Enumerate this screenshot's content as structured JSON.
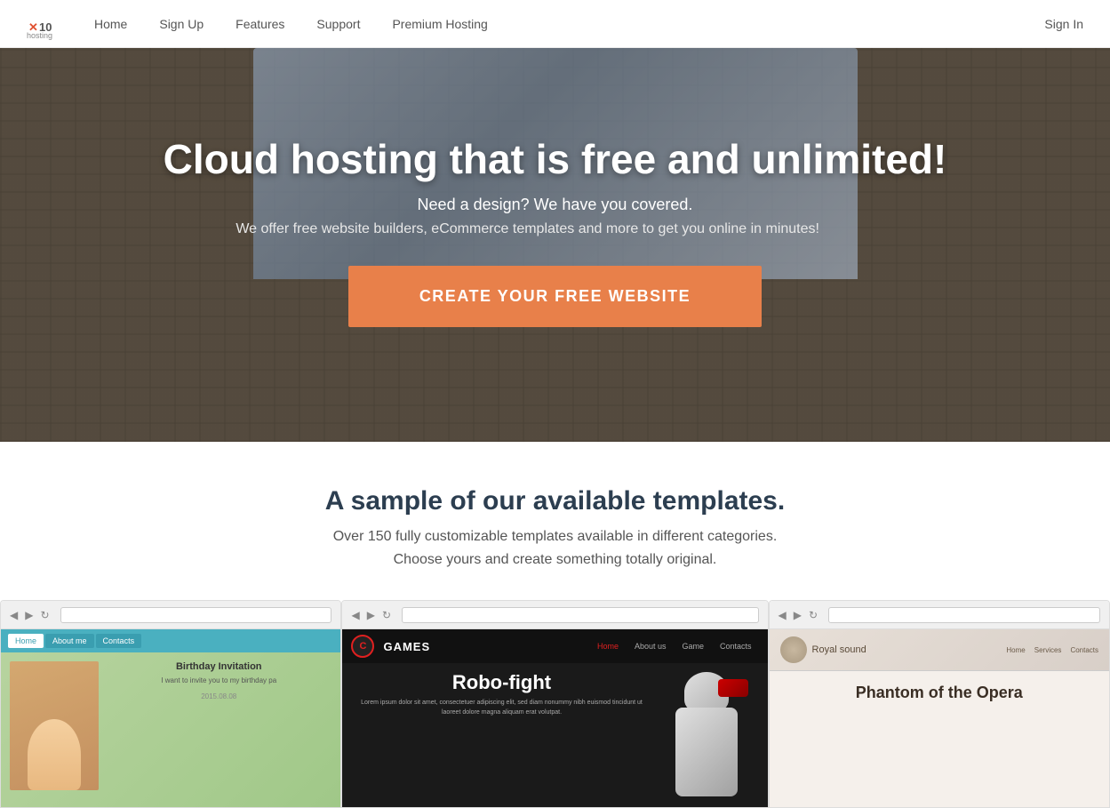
{
  "site": {
    "logo_text": "10hosting",
    "logo_icon": "✕"
  },
  "navbar": {
    "links": [
      {
        "label": "Home",
        "id": "nav-home"
      },
      {
        "label": "Sign Up",
        "id": "nav-signup"
      },
      {
        "label": "Features",
        "id": "nav-features"
      },
      {
        "label": "Support",
        "id": "nav-support"
      },
      {
        "label": "Premium Hosting",
        "id": "nav-premium"
      }
    ],
    "signin": "Sign In"
  },
  "hero": {
    "title": "Cloud hosting that is free and unlimited!",
    "subtitle": "Need a design? We have you covered.",
    "description": "We offer free website builders, eCommerce templates and more to get you online in minutes!",
    "cta": "CREATE YOUR FREE WEBSITE"
  },
  "templates": {
    "title": "A sample of our available templates.",
    "subtitle": "Over 150 fully customizable templates available in different categories.",
    "tagline": "Choose yours and create something totally original.",
    "previews": [
      {
        "id": "birthday",
        "nav_items": [
          "Home",
          "About me",
          "Contacts"
        ],
        "title": "Birthday Invitation",
        "body": "I want to invite you to my birthday pa",
        "date": "2015.08.08"
      },
      {
        "id": "games",
        "logo_letter": "C",
        "brand": "GAMES",
        "nav_items": [
          "Home",
          "About us",
          "Game",
          "Contacts"
        ],
        "main_title": "Robo-fight",
        "body": "Lorem ipsum dolor sit amet, consectetuer adipiscing elit, sed diam nonummy nibh euismod tincidunt ut laoreet dolore magna aliquam erat volutpat."
      },
      {
        "id": "royal",
        "brand": "Royal sound",
        "nav_items": [
          "Home",
          "Services",
          "Contacts"
        ],
        "main_title": "Phantom of the Opera"
      }
    ]
  },
  "colors": {
    "cta_bg": "#e8804a",
    "hero_overlay": "rgba(80,70,60,0.55)",
    "brand_red": "#e02020",
    "accent_teal": "#4ab0c0"
  }
}
